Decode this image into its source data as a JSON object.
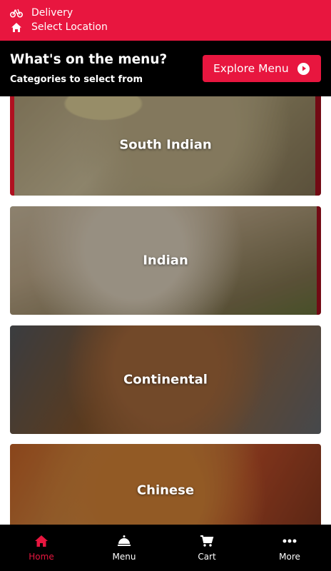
{
  "topbar": {
    "delivery_label": "Delivery",
    "location_label": "Select Location",
    "color": "#e8163f"
  },
  "header": {
    "title": "What's on the menu?",
    "subtitle": "Categories to select from",
    "explore_label": "Explore Menu"
  },
  "categories": [
    {
      "label": "South Indian"
    },
    {
      "label": "Indian"
    },
    {
      "label": "Continental"
    },
    {
      "label": "Chinese"
    }
  ],
  "bottom_nav": [
    {
      "label": "Home",
      "icon": "home-icon",
      "active": true
    },
    {
      "label": "Menu",
      "icon": "cloche-icon",
      "active": false
    },
    {
      "label": "Cart",
      "icon": "cart-icon",
      "active": false
    },
    {
      "label": "More",
      "icon": "more-icon",
      "active": false
    }
  ]
}
